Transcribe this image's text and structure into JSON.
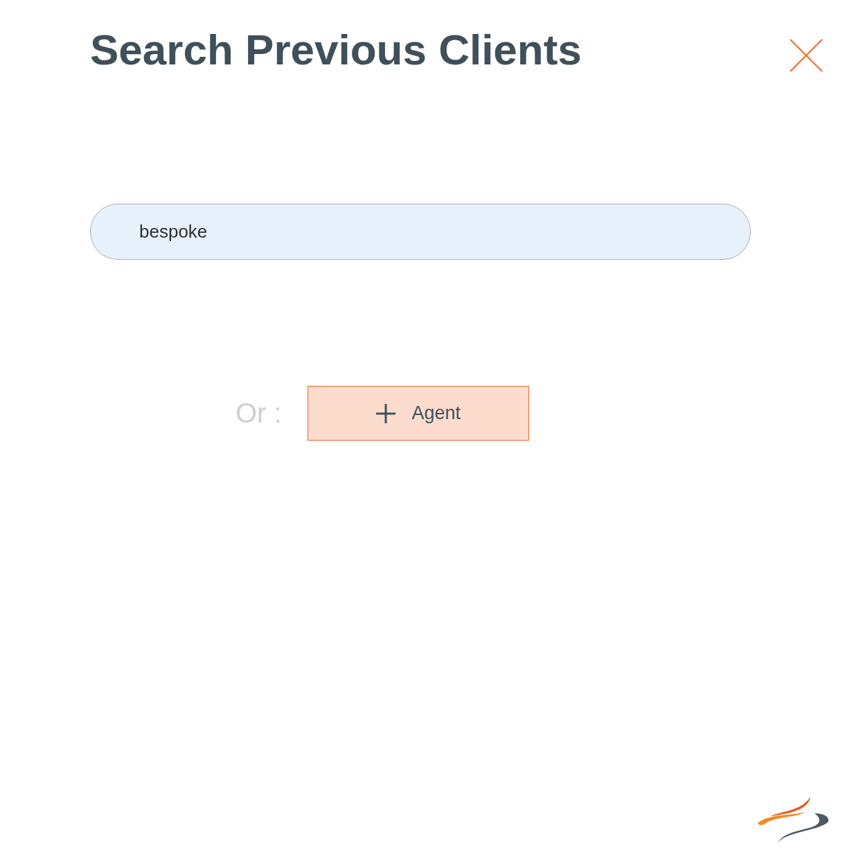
{
  "title": "Search Previous Clients",
  "search": {
    "value": "bespoke"
  },
  "alternative": {
    "label": "Or :",
    "button": {
      "label": "Agent"
    }
  }
}
